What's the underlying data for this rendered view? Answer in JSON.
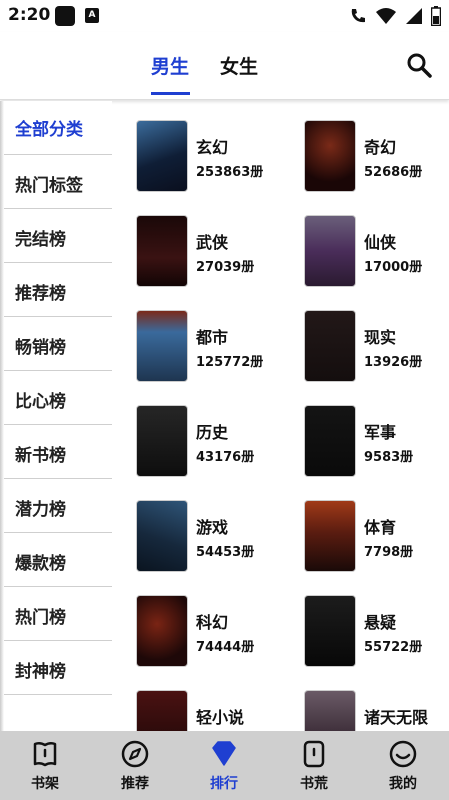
{
  "status_bar": {
    "time": "2:20",
    "badge": "A"
  },
  "header": {
    "tabs": [
      {
        "label": "男生",
        "active": true
      },
      {
        "label": "女生",
        "active": false
      }
    ],
    "search_icon": "search-icon",
    "accent_color": "#1f3fd1"
  },
  "sidebar": {
    "items": [
      {
        "label": "全部分类",
        "active": true
      },
      {
        "label": "热门标签",
        "active": false
      },
      {
        "label": "完结榜",
        "active": false
      },
      {
        "label": "推荐榜",
        "active": false
      },
      {
        "label": "畅销榜",
        "active": false
      },
      {
        "label": "比心榜",
        "active": false
      },
      {
        "label": "新书榜",
        "active": false
      },
      {
        "label": "潜力榜",
        "active": false
      },
      {
        "label": "爆款榜",
        "active": false
      },
      {
        "label": "热门榜",
        "active": false
      },
      {
        "label": "封神榜",
        "active": false
      }
    ]
  },
  "categories": [
    {
      "name": "玄幻",
      "count": "253863册",
      "cover_color": "#1e3a5f"
    },
    {
      "name": "奇幻",
      "count": "52686册",
      "cover_color": "#3a0e0e"
    },
    {
      "name": "武侠",
      "count": "27039册",
      "cover_color": "#2b0d0d"
    },
    {
      "name": "仙侠",
      "count": "17000册",
      "cover_color": "#4a2a4e"
    },
    {
      "name": "都市",
      "count": "125772册",
      "cover_color": "#2d4c6e"
    },
    {
      "name": "现实",
      "count": "13926册",
      "cover_color": "#1b1414"
    },
    {
      "name": "历史",
      "count": "43176册",
      "cover_color": "#1a1a1a"
    },
    {
      "name": "军事",
      "count": "9583册",
      "cover_color": "#161616"
    },
    {
      "name": "游戏",
      "count": "54453册",
      "cover_color": "#1d3347"
    },
    {
      "name": "体育",
      "count": "7798册",
      "cover_color": "#5a1c10"
    },
    {
      "name": "科幻",
      "count": "74444册",
      "cover_color": "#3d1410"
    },
    {
      "name": "悬疑",
      "count": "55722册",
      "cover_color": "#141414"
    },
    {
      "name": "轻小说",
      "count": "",
      "cover_color": "#3a1010"
    },
    {
      "name": "诸天无限",
      "count": "",
      "cover_color": "#3e2f3a"
    }
  ],
  "bottom_nav": [
    {
      "label": "书架",
      "icon": "bookshelf-icon",
      "active": false
    },
    {
      "label": "推荐",
      "icon": "compass-icon",
      "active": false
    },
    {
      "label": "排行",
      "icon": "diamond-icon",
      "active": true
    },
    {
      "label": "书荒",
      "icon": "book-icon",
      "active": false
    },
    {
      "label": "我的",
      "icon": "smiley-icon",
      "active": false
    }
  ]
}
